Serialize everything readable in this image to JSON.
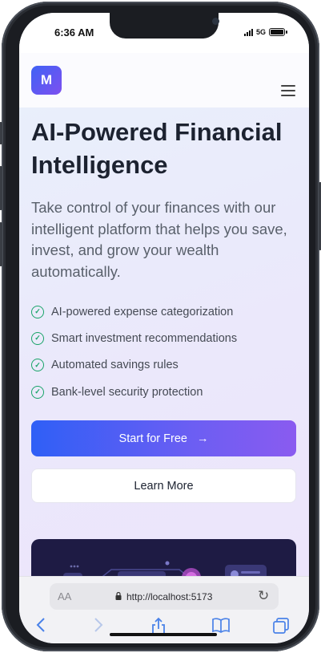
{
  "status_bar": {
    "time": "6:36 AM",
    "network": "5G"
  },
  "header": {
    "logo_letter": "M"
  },
  "hero": {
    "title": "AI-Powered Financial Intelligence",
    "subtitle": "Take control of your finances with our intelligent platform that helps you save, invest, and grow your wealth automatically.",
    "features": [
      "AI-powered expense categorization",
      "Smart investment recommendations",
      "Automated savings rules",
      "Bank-level security protection"
    ],
    "primary_button": "Start for Free",
    "secondary_button": "Learn More"
  },
  "browser": {
    "aa_label": "AA",
    "url": "http://localhost:5173"
  },
  "colors": {
    "accent_start": "#2f5ff6",
    "accent_end": "#8a5bf0",
    "check_green": "#18a468"
  }
}
